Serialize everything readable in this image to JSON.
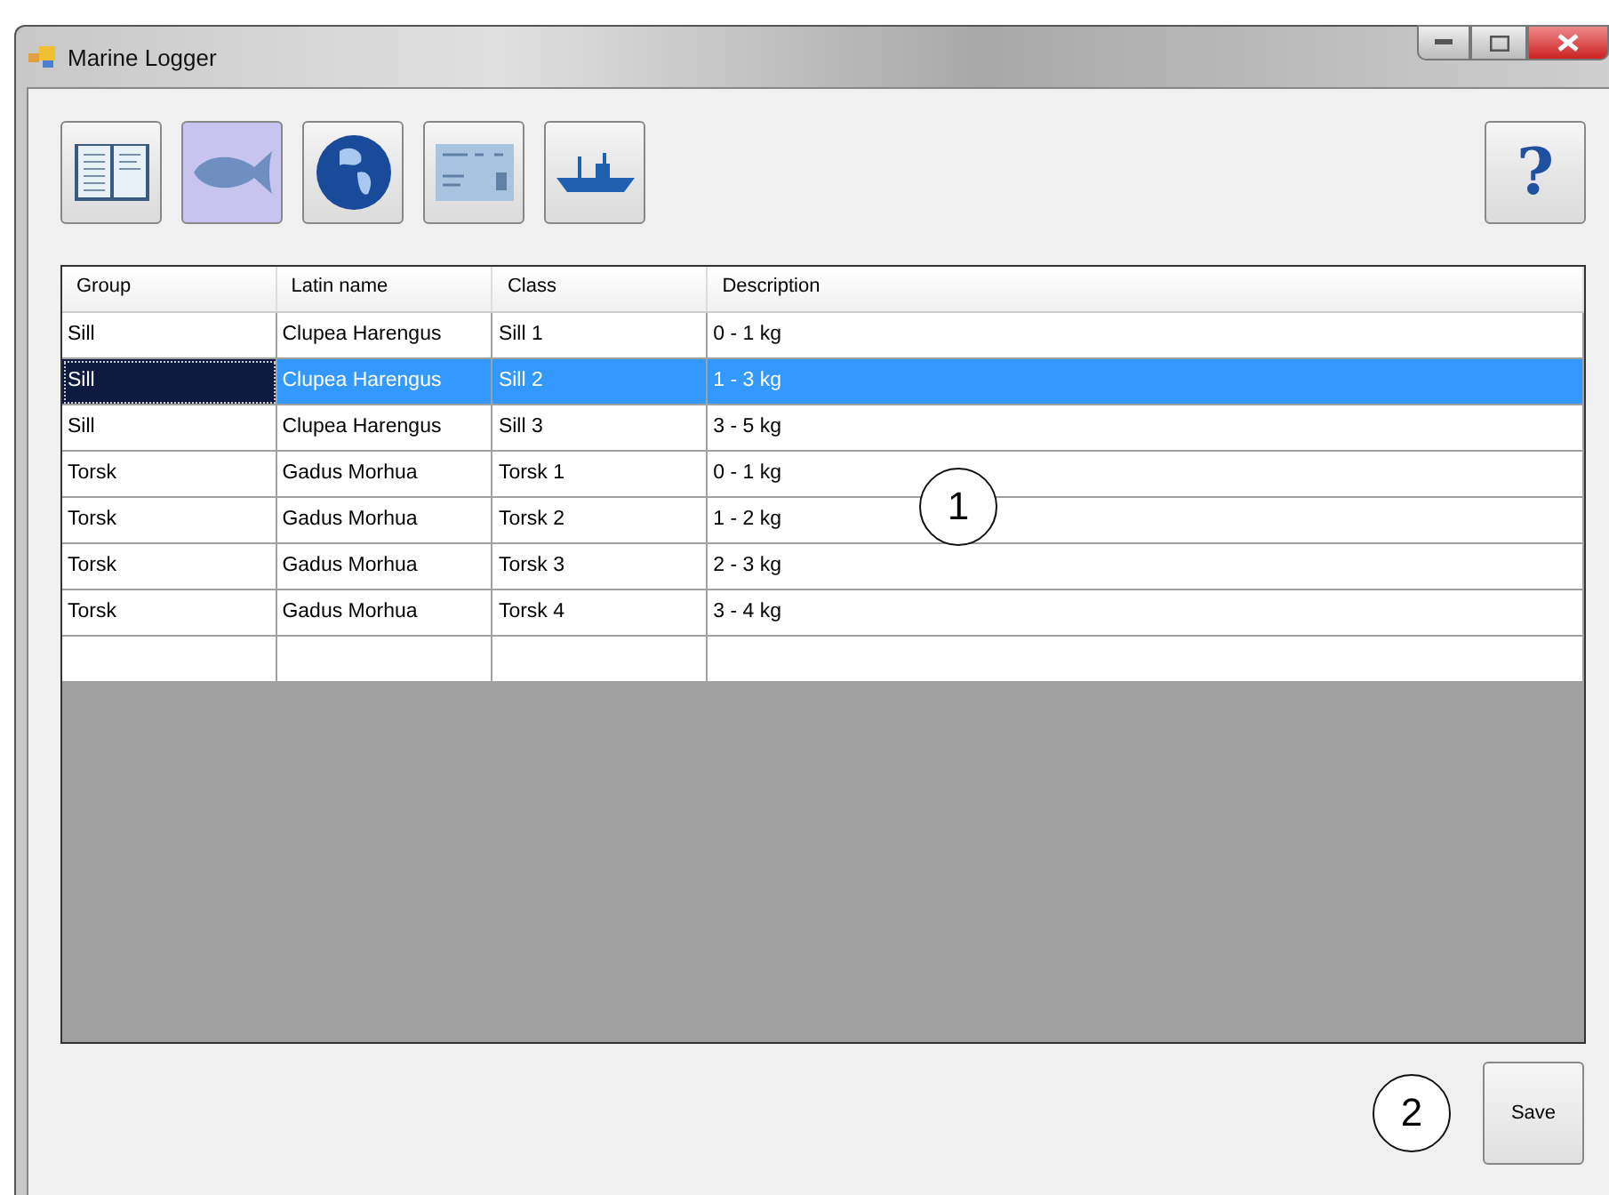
{
  "window": {
    "title": "Marine Logger"
  },
  "toolbar": [
    {
      "kind": "book",
      "selected": false
    },
    {
      "kind": "fish",
      "selected": true
    },
    {
      "kind": "globe",
      "selected": false
    },
    {
      "kind": "card",
      "selected": false
    },
    {
      "kind": "ship",
      "selected": false
    }
  ],
  "help_button": {
    "label": "?"
  },
  "table": {
    "columns": [
      "Group",
      "Latin name",
      "Class",
      "Description"
    ],
    "rows": [
      {
        "cells": [
          "Sill",
          "Clupea Harengus",
          "Sill 1",
          "0 - 1 kg"
        ],
        "selected": false
      },
      {
        "cells": [
          "Sill",
          "Clupea Harengus",
          "Sill 2",
          "1 - 3 kg"
        ],
        "selected": true
      },
      {
        "cells": [
          "Sill",
          "Clupea Harengus",
          "Sill 3",
          "3 - 5 kg"
        ],
        "selected": false
      },
      {
        "cells": [
          "Torsk",
          "Gadus Morhua",
          "Torsk 1",
          "0 - 1 kg"
        ],
        "selected": false
      },
      {
        "cells": [
          "Torsk",
          "Gadus Morhua",
          "Torsk 2",
          "1 - 2 kg"
        ],
        "selected": false
      },
      {
        "cells": [
          "Torsk",
          "Gadus Morhua",
          "Torsk 3",
          "2 - 3 kg"
        ],
        "selected": false
      },
      {
        "cells": [
          "Torsk",
          "Gadus Morhua",
          "Torsk 4",
          "3 - 4 kg"
        ],
        "selected": false
      }
    ]
  },
  "callouts": [
    "1",
    "2"
  ],
  "save_button": {
    "label": "Save"
  }
}
